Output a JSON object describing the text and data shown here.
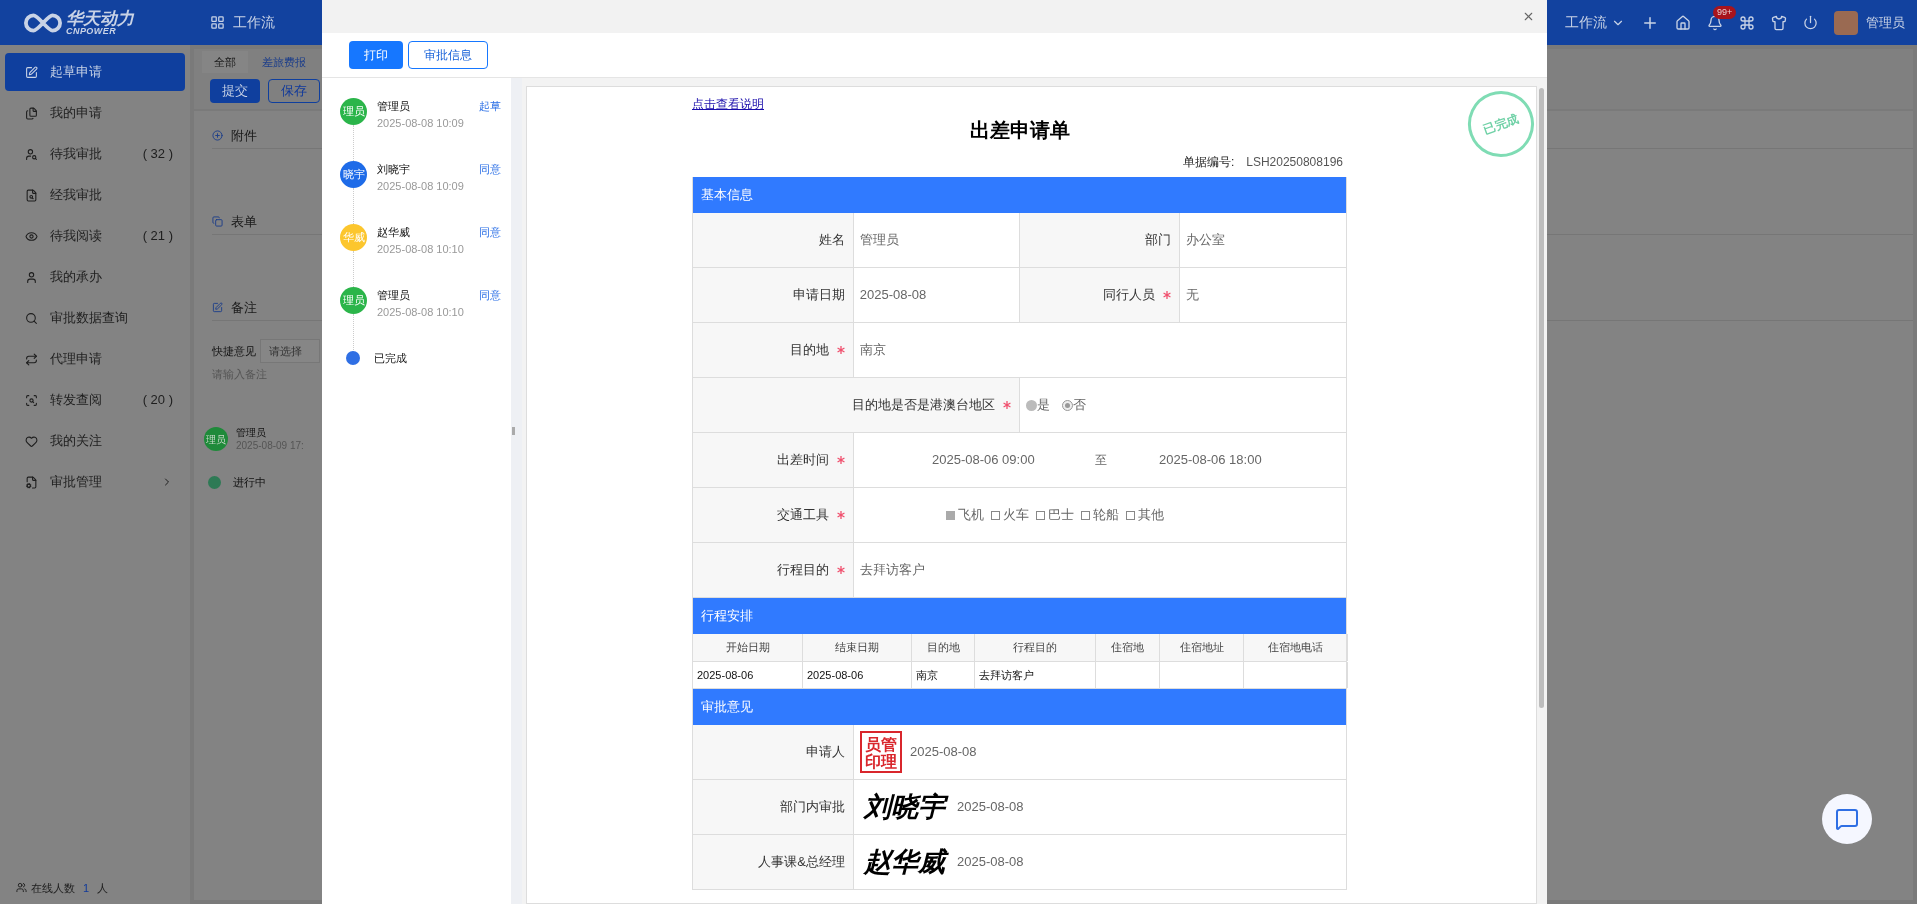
{
  "header": {
    "logo_text": "华天动力",
    "logo_sub": "CNPOWER",
    "module": "工作流",
    "menu": "工作流",
    "notification_badge": "99+",
    "user": "管理员"
  },
  "sidebar": {
    "items": [
      {
        "label": "起草申请",
        "selected": true,
        "expandable": false
      },
      {
        "label": "我的申请",
        "selected": false,
        "expandable": false
      },
      {
        "label": "待我审批",
        "count": "( 32 )",
        "selected": false,
        "expandable": false
      },
      {
        "label": "经我审批",
        "selected": false,
        "expandable": false
      },
      {
        "label": "待我阅读",
        "count": "( 21 )",
        "selected": false,
        "expandable": false
      },
      {
        "label": "我的承办",
        "selected": false,
        "expandable": false
      },
      {
        "label": "审批数据查询",
        "selected": false,
        "expandable": false
      },
      {
        "label": "代理申请",
        "selected": false,
        "expandable": false
      },
      {
        "label": "转发查阅",
        "count": "( 20 )",
        "selected": false,
        "expandable": false
      },
      {
        "label": "我的关注",
        "selected": false,
        "expandable": false
      },
      {
        "label": "审批管理",
        "selected": false,
        "expandable": true
      }
    ],
    "online": {
      "label": "在线人数",
      "count": "1",
      "unit": "人"
    }
  },
  "main": {
    "tabs": [
      {
        "label": "全部",
        "selected": true
      },
      {
        "label": "差旅费报",
        "selected": false
      }
    ],
    "buttons": [
      {
        "label": "提交",
        "kind": "primary"
      },
      {
        "label": "保存",
        "kind": "outline"
      }
    ],
    "sections": [
      "附件",
      "表单",
      "备注"
    ],
    "quick_opinion": {
      "label": "快捷意见",
      "placeholder": "请选择"
    },
    "remark_placeholder": "请输入备注",
    "timeline": [
      {
        "initials": "理员",
        "name": "管理员",
        "time": "2025-08-09 17:",
        "color": "#1f8a3a"
      }
    ],
    "status": "进行中"
  },
  "dialog": {
    "toolbar": [
      {
        "label": "打印",
        "kind": "primary"
      },
      {
        "label": "审批信息",
        "kind": "outline"
      }
    ],
    "flow": [
      {
        "initials": "理员",
        "name": "管理员",
        "time": "2025-08-08 10:09",
        "action": "起草",
        "color": "#2bb54a"
      },
      {
        "initials": "晓宇",
        "name": "刘晓宇",
        "time": "2025-08-08 10:09",
        "action": "同意",
        "color": "#1e6be8"
      },
      {
        "initials": "华威",
        "name": "赵华威",
        "time": "2025-08-08 10:10",
        "action": "同意",
        "color": "#fcc62d"
      },
      {
        "initials": "理员",
        "name": "管理员",
        "time": "2025-08-08 10:10",
        "action": "同意",
        "color": "#2bb54a"
      }
    ],
    "flow_end": "已完成",
    "form": {
      "help_link": "点击查看说明",
      "title": "出差申请单",
      "number_label": "单据编号:",
      "number": "LSH20250808196",
      "stamp": "已完成",
      "sections": [
        {
          "kind": "fields",
          "title": "基本信息",
          "rows": [
            {
              "kind": "pair",
              "fields": [
                {
                  "label": "姓名",
                  "value": "管理员",
                  "required": false
                },
                {
                  "label": "部门",
                  "value": "办公室",
                  "required": false
                }
              ]
            },
            {
              "kind": "pair",
              "fields": [
                {
                  "label": "申请日期",
                  "value": "2025-08-08",
                  "required": false
                },
                {
                  "label": "同行人员",
                  "value": "无",
                  "required": true
                }
              ]
            },
            {
              "kind": "text",
              "label": "目的地",
              "value": "南京",
              "required": true
            },
            {
              "kind": "radio",
              "label": "目的地是否是港澳台地区",
              "required": true,
              "options": [
                {
                  "label": "是",
                  "selected": false
                },
                {
                  "label": "否",
                  "selected": true
                }
              ]
            },
            {
              "kind": "range",
              "label": "出差时间",
              "required": true,
              "start": "2025-08-06 09:00",
              "separator": "至",
              "end": "2025-08-06 18:00"
            },
            {
              "kind": "checkbox",
              "label": "交通工具",
              "required": true,
              "options": [
                {
                  "label": "飞机",
                  "checked": true
                },
                {
                  "label": "火车",
                  "checked": false
                },
                {
                  "label": "巴士",
                  "checked": false
                },
                {
                  "label": "轮船",
                  "checked": false
                },
                {
                  "label": "其他",
                  "checked": false
                }
              ]
            },
            {
              "kind": "text",
              "label": "行程目的",
              "value": "去拜访客户",
              "required": true
            }
          ]
        },
        {
          "kind": "table",
          "title": "行程安排",
          "columns": [
            "开始日期",
            "结束日期",
            "目的地",
            "行程目的",
            "住宿地",
            "住宿地址",
            "住宿地电话"
          ],
          "rows": [
            [
              "2025-08-06",
              "2025-08-06",
              "南京",
              "去拜访客户"
            ]
          ]
        },
        {
          "kind": "approvals",
          "title": "审批意见",
          "rows": [
            {
              "label": "申请人",
              "kind": "seal",
              "mark": "员管印理",
              "date": "2025-08-08"
            },
            {
              "label": "部门内审批",
              "kind": "signature",
              "mark": "刘晓宇",
              "date": "2025-08-08"
            },
            {
              "label": "人事课&总经理",
              "kind": "signature",
              "mark": "赵华威",
              "date": "2025-08-08"
            }
          ]
        }
      ]
    }
  }
}
